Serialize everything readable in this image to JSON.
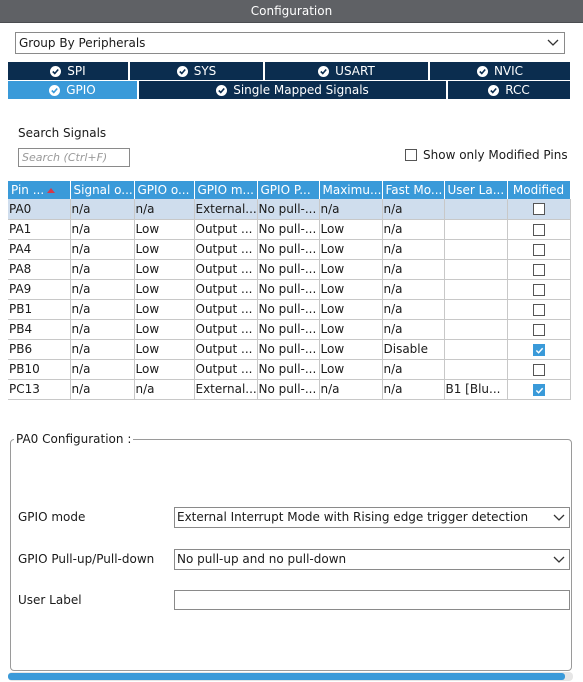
{
  "window": {
    "title": "Configuration"
  },
  "group_by": {
    "value": "Group By Peripherals"
  },
  "tabs_row1": [
    {
      "label": "SPI"
    },
    {
      "label": "SYS"
    },
    {
      "label": "USART"
    },
    {
      "label": "NVIC"
    }
  ],
  "tabs_row2": [
    {
      "label": "GPIO",
      "active": true
    },
    {
      "label": "Single Mapped Signals"
    },
    {
      "label": "RCC"
    }
  ],
  "search": {
    "label": "Search Signals",
    "placeholder": "Search (Ctrl+F)"
  },
  "show_modified": {
    "label": "Show only Modified Pins",
    "checked": false
  },
  "table": {
    "headers": [
      "Pin ...",
      "Signal o...",
      "GPIO o...",
      "GPIO m...",
      "GPIO P...",
      "Maximu...",
      "Fast Mo...",
      "User La...",
      "Modified"
    ],
    "rows": [
      {
        "cells": [
          "PA0",
          "n/a",
          "n/a",
          "External...",
          "No pull-...",
          "n/a",
          "n/a",
          ""
        ],
        "modified": false,
        "selected": true
      },
      {
        "cells": [
          "PA1",
          "n/a",
          "Low",
          "Output ...",
          "No pull-...",
          "Low",
          "n/a",
          ""
        ],
        "modified": false
      },
      {
        "cells": [
          "PA4",
          "n/a",
          "Low",
          "Output ...",
          "No pull-...",
          "Low",
          "n/a",
          ""
        ],
        "modified": false
      },
      {
        "cells": [
          "PA8",
          "n/a",
          "Low",
          "Output ...",
          "No pull-...",
          "Low",
          "n/a",
          ""
        ],
        "modified": false
      },
      {
        "cells": [
          "PA9",
          "n/a",
          "Low",
          "Output ...",
          "No pull-...",
          "Low",
          "n/a",
          ""
        ],
        "modified": false
      },
      {
        "cells": [
          "PB1",
          "n/a",
          "Low",
          "Output ...",
          "No pull-...",
          "Low",
          "n/a",
          ""
        ],
        "modified": false
      },
      {
        "cells": [
          "PB4",
          "n/a",
          "Low",
          "Output ...",
          "No pull-...",
          "Low",
          "n/a",
          ""
        ],
        "modified": false
      },
      {
        "cells": [
          "PB6",
          "n/a",
          "Low",
          "Output ...",
          "No pull-...",
          "Low",
          "Disable",
          ""
        ],
        "modified": true
      },
      {
        "cells": [
          "PB10",
          "n/a",
          "Low",
          "Output ...",
          "No pull-...",
          "Low",
          "n/a",
          ""
        ],
        "modified": false
      },
      {
        "cells": [
          "PC13",
          "n/a",
          "n/a",
          "External...",
          "No pull-...",
          "n/a",
          "n/a",
          "B1 [Blu..."
        ],
        "modified": true
      }
    ]
  },
  "pin_config": {
    "title": "PA0 Configuration :",
    "gpio_mode": {
      "label": "GPIO mode",
      "value": "External Interrupt Mode with Rising edge trigger detection"
    },
    "gpio_pull": {
      "label": "GPIO Pull-up/Pull-down",
      "value": "No pull-up and no pull-down"
    },
    "user_label": {
      "label": "User Label",
      "value": ""
    }
  },
  "colors": {
    "tab_dark": "#0b2d4f",
    "accent": "#3a9ad9",
    "titlebar": "#5f6165",
    "selected_row": "#cfdded"
  }
}
